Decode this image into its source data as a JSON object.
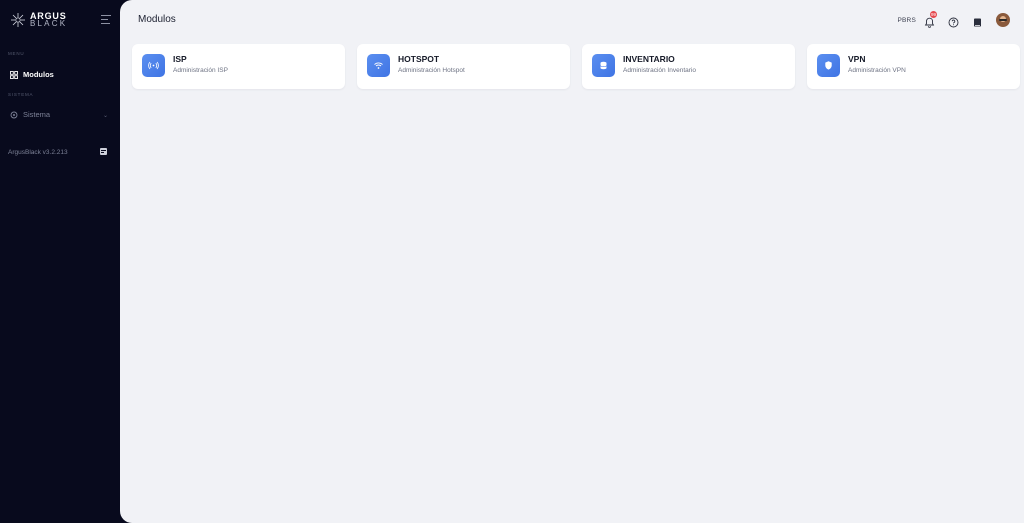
{
  "sidebar": {
    "logo": {
      "line1": "ARGUS",
      "line2": "BLACK"
    },
    "sections": [
      {
        "label": "MENU"
      },
      {
        "label": "SISTEMA"
      }
    ],
    "items": [
      {
        "label": "Modulos",
        "icon": "grid-icon"
      },
      {
        "label": "Sistema",
        "icon": "gear-icon"
      }
    ],
    "version": "ArgusBlack v3.2.213"
  },
  "header": {
    "title": "Modulos",
    "org": "PBRS",
    "notification_count": "99"
  },
  "modules": [
    {
      "title": "ISP",
      "subtitle": "Administración ISP",
      "icon": "antenna-icon"
    },
    {
      "title": "HOTSPOT",
      "subtitle": "Administración Hotspot",
      "icon": "wifi-icon"
    },
    {
      "title": "INVENTARIO",
      "subtitle": "Administración Inventario",
      "icon": "database-icon"
    },
    {
      "title": "VPN",
      "subtitle": "Administración VPN",
      "icon": "shield-icon"
    }
  ],
  "colors": {
    "sidebar_bg": "#080a1d",
    "main_bg": "#f1f2f6",
    "accent": "#4a7ff0",
    "badge": "#e5484d"
  }
}
